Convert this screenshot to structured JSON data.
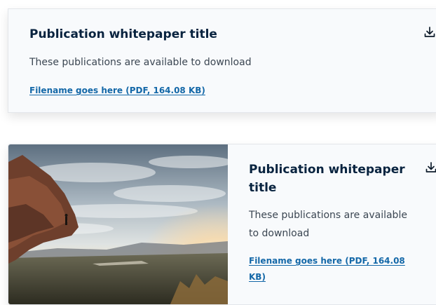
{
  "cards": [
    {
      "title": "Publication whitepaper title",
      "description": "These publications are available to download",
      "file_link": "Filename goes here (PDF, 164.08 KB)",
      "icon": "download-icon"
    },
    {
      "title": "Publication whitepaper title",
      "description": "These publications are available to download",
      "file_link": "Filename goes here (PDF, 164.08 KB)",
      "icon": "download-icon",
      "image": "landscape-photo"
    }
  ],
  "colors": {
    "title": "#08233f",
    "link": "#1468a8",
    "card_background": "#f8fafc"
  }
}
